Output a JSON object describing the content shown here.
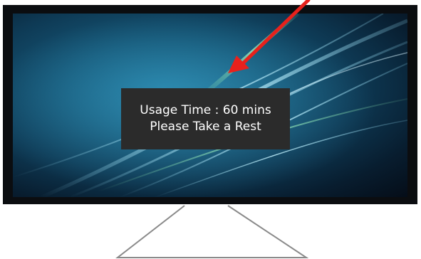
{
  "notification": {
    "line1": "Usage Time : 60 mins",
    "line2": "Please Take a Rest"
  },
  "colors": {
    "bezel": "#0b0d10",
    "screen_base": "#0e3a55",
    "streak_light": "#8fd8f0",
    "streak_green": "#7fd9a8",
    "notification_bg": "#2b2b2b",
    "notification_text": "#ffffff",
    "arrow": "#e8211c",
    "stand": "#8a8a8a"
  }
}
